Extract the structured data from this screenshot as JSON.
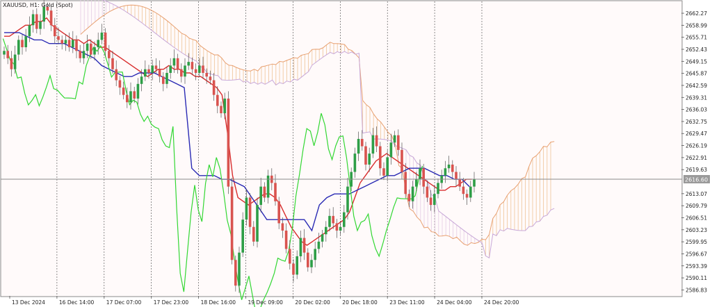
{
  "chart_data": {
    "type": "candlestick",
    "title": "XAUUSD, H1:  Gold (Spot)",
    "current_price": "2616.60",
    "y_ticks": [
      "2662.27",
      "2658.99",
      "2655.71",
      "2652.43",
      "2649.15",
      "2645.87",
      "2642.59",
      "2639.31",
      "2636.03",
      "2632.75",
      "2629.47",
      "2626.19",
      "2622.91",
      "2619.63",
      "2613.07",
      "2609.79",
      "2606.51",
      "2603.23",
      "2599.95",
      "2596.67",
      "2593.39",
      "2590.11",
      "2586.83"
    ],
    "y_range": [
      2585.2,
      2665.5
    ],
    "x_labels": [
      "13 Dec 2024",
      "16 Dec 14:00",
      "17 Dec 07:00",
      "17 Dec 23:00",
      "18 Dec 16:00",
      "19 Dec 09:00",
      "20 Dec 02:00",
      "20 Dec 18:00",
      "23 Dec 11:00",
      "24 Dec 04:00",
      "24 Dec 20:00"
    ],
    "grid": "vertical-dashed",
    "colors": {
      "bull": "#2e9e47",
      "bear": "#d9534f",
      "tenkan": "#d82c2c",
      "kijun": "#2a2ab4",
      "chikou": "#32d732",
      "span_a": "#e8a070",
      "span_b": "#c8a8d8",
      "cloud_bull": "#f0c8a0",
      "cloud_bear": "#e6d0e6"
    },
    "candles_close": [
      2652,
      2650,
      2647,
      2651,
      2655,
      2653,
      2656,
      2659,
      2662,
      2658,
      2660,
      2664,
      2663,
      2659,
      2656,
      2655,
      2654,
      2655,
      2653,
      2655,
      2652,
      2650,
      2652,
      2654,
      2651,
      2653,
      2655,
      2657,
      2652,
      2650,
      2647,
      2644,
      2642,
      2640,
      2638,
      2641,
      2639,
      2643,
      2645,
      2647,
      2646,
      2648,
      2647,
      2645,
      2643,
      2646,
      2648,
      2650,
      2647,
      2645,
      2648,
      2649,
      2647,
      2646,
      2648,
      2646,
      2645,
      2644,
      2640,
      2637,
      2635,
      2639,
      2615,
      2595,
      2588,
      2597,
      2606,
      2612,
      2604,
      2600,
      2610,
      2615,
      2612,
      2618,
      2616,
      2611,
      2605,
      2603,
      2598,
      2594,
      2591,
      2596,
      2601,
      2597,
      2593,
      2595,
      2598,
      2600,
      2602,
      2604,
      2607,
      2605,
      2603,
      2604,
      2608,
      2615,
      2619,
      2624,
      2628,
      2626,
      2621,
      2624,
      2629,
      2626,
      2620,
      2618,
      2623,
      2627,
      2629,
      2625,
      2619,
      2613,
      2611,
      2615,
      2617,
      2620,
      2615,
      2612,
      2610,
      2613,
      2616,
      2618,
      2620,
      2621,
      2619,
      2617,
      2615,
      2613,
      2612,
      2615,
      2617
    ],
    "tenkan": [
      2656,
      2656,
      2657,
      2658,
      2659,
      2659,
      2660,
      2660,
      2661,
      2659,
      2658,
      2657,
      2656,
      2655,
      2655,
      2654,
      2655,
      2654,
      2653,
      2653,
      2652,
      2651,
      2650,
      2649,
      2648,
      2647,
      2646,
      2645,
      2646,
      2647,
      2647,
      2648,
      2647,
      2647,
      2646,
      2646,
      2645,
      2645,
      2644,
      2643,
      2642,
      2640,
      2630,
      2618,
      2612,
      2611,
      2610,
      2611,
      2612,
      2613,
      2613,
      2612,
      2610,
      2607,
      2604,
      2602,
      2600,
      2599,
      2600,
      2601,
      2602,
      2603,
      2604,
      2605,
      2606,
      2608,
      2612,
      2616,
      2618,
      2620,
      2622,
      2623,
      2624,
      2623,
      2622,
      2621,
      2620,
      2619,
      2618,
      2617,
      2616,
      2615,
      2614,
      2614,
      2615,
      2615,
      2616,
      2617,
      2617
    ],
    "kijun": [
      2657,
      2657,
      2657,
      2656,
      2655,
      2655,
      2654,
      2654,
      2654,
      2653,
      2652,
      2651,
      2650,
      2648,
      2647,
      2646,
      2645,
      2645,
      2646,
      2646,
      2646,
      2645,
      2644,
      2643,
      2642,
      2620,
      2618,
      2618,
      2618,
      2617,
      2617,
      2616,
      2615,
      2612,
      2609,
      2606,
      2606,
      2606,
      2606,
      2606,
      2606,
      2603,
      2610,
      2612,
      2613,
      2613,
      2613,
      2614,
      2615,
      2616,
      2617,
      2618,
      2618,
      2619,
      2620,
      2620,
      2620,
      2619,
      2618,
      2618,
      2617,
      2617,
      2615
    ]
  }
}
